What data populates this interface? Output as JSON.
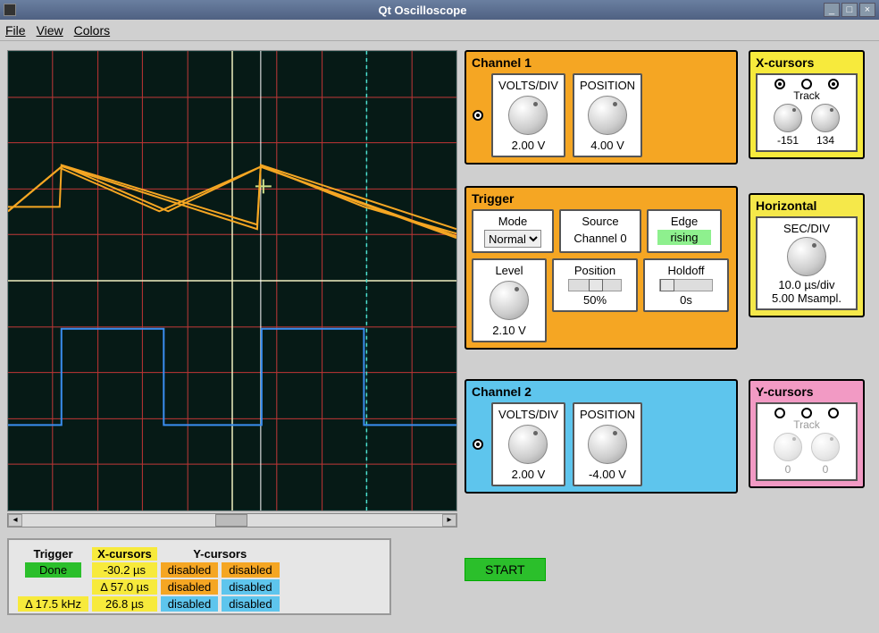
{
  "window": {
    "title": "Qt Oscilloscope"
  },
  "menu": {
    "file": "File",
    "view": "View",
    "colors": "Colors"
  },
  "channel1": {
    "title": "Channel 1",
    "volts_label": "VOLTS/DIV",
    "volts_value": "2.00 V",
    "pos_label": "POSITION",
    "pos_value": "4.00 V"
  },
  "channel2": {
    "title": "Channel 2",
    "volts_label": "VOLTS/DIV",
    "volts_value": "2.00 V",
    "pos_label": "POSITION",
    "pos_value": "-4.00 V"
  },
  "trigger": {
    "title": "Trigger",
    "mode_label": "Mode",
    "mode_value": "Normal",
    "source_label": "Source",
    "source_value": "Channel 0",
    "edge_label": "Edge",
    "edge_value": "rising",
    "level_label": "Level",
    "level_value": "2.10 V",
    "position_label": "Position",
    "position_value": "50%",
    "holdoff_label": "Holdoff",
    "holdoff_value": "0s"
  },
  "xcursors": {
    "title": "X-cursors",
    "track": "Track",
    "left_value": "-151",
    "right_value": "134"
  },
  "ycursors": {
    "title": "Y-cursors",
    "track": "Track",
    "left_value": "0",
    "right_value": "0"
  },
  "horizontal": {
    "title": "Horizontal",
    "secdiv_label": "SEC/DIV",
    "secdiv_value": "10.0 µs/div",
    "sample_value": "5.00 Msampl."
  },
  "status": {
    "trigger_h": "Trigger",
    "xh": "X-cursors",
    "yh": "Y-cursors",
    "trigger_state": "Done",
    "trigger_delta": "Δ 17.5 kHz",
    "x1": "-30.2 µs",
    "x2": "Δ 57.0 µs",
    "x3": "26.8 µs",
    "y_disabled": "disabled"
  },
  "start_button": "START"
}
